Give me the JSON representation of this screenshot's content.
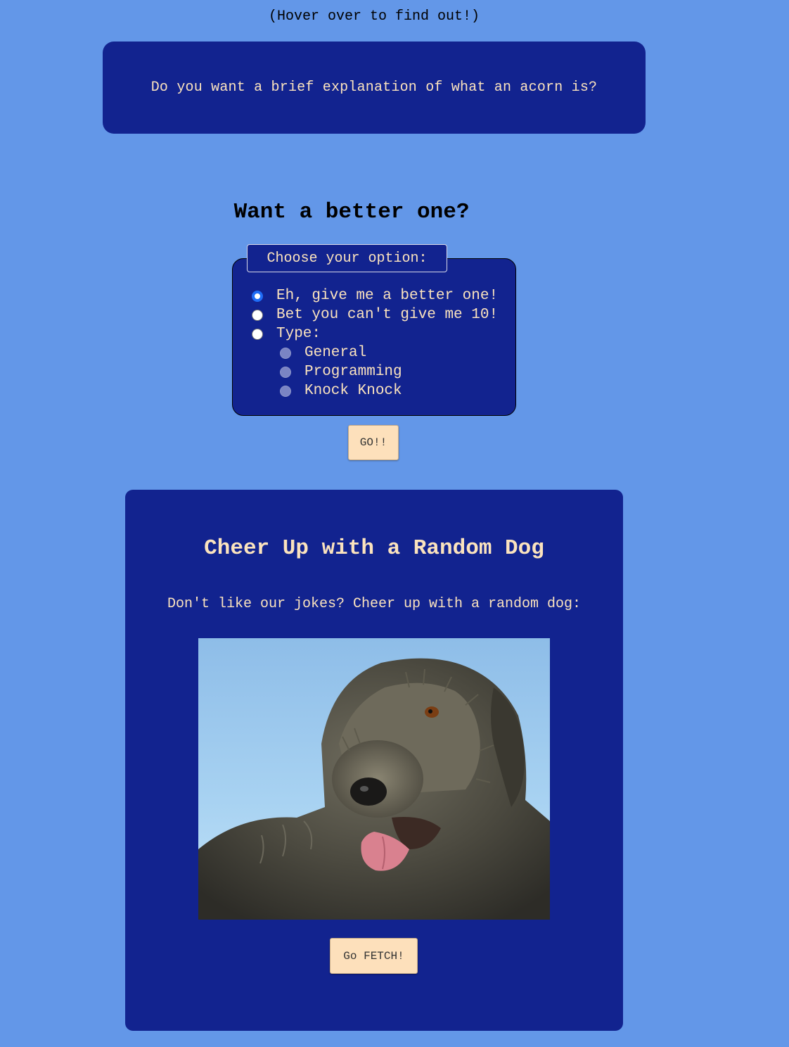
{
  "hover_hint": "(Hover over to find out!)",
  "acorn": {
    "question": "Do you want a brief explanation of what an acorn is?"
  },
  "joke_form": {
    "title": "Want a better one?",
    "legend": "Choose your option:",
    "options": [
      {
        "label": "Eh, give me a better one!",
        "checked": true
      },
      {
        "label": "Bet you can't give me 10!",
        "checked": false
      },
      {
        "label": "Type:",
        "checked": false
      }
    ],
    "types": [
      {
        "label": "General",
        "disabled": true
      },
      {
        "label": "Programming",
        "disabled": true
      },
      {
        "label": "Knock Knock",
        "disabled": true
      }
    ],
    "submit_label": "GO!!"
  },
  "dog": {
    "title": "Cheer Up with a Random Dog",
    "subtitle": "Don't like our jokes? Cheer up with a random dog:",
    "image_icon": "dog-photo",
    "fetch_label": "Go FETCH!"
  },
  "colors": {
    "page_background": "#6397e8",
    "panel": "#12238f",
    "panel_text": "#fbe3be",
    "button": "#fde0bb",
    "radio_checked": "#1f6cf6"
  }
}
